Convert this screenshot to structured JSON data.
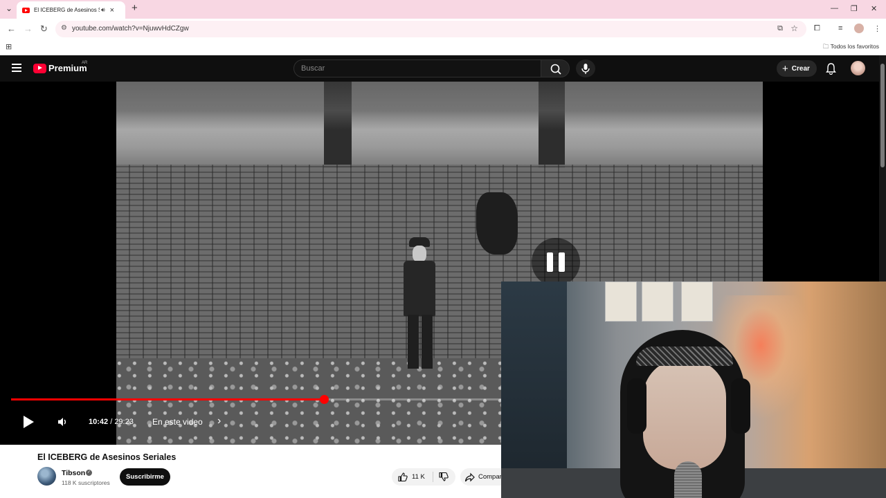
{
  "browser": {
    "tab_title": "El ICEBERG de Asesinos Seriales - YouTube",
    "url": "youtube.com/watch?v=NjuwvHdCZgw",
    "bookmarks_all": "Todos los favoritos"
  },
  "youtube": {
    "logo_text": "Premium",
    "logo_country": "AR",
    "search_placeholder": "Buscar",
    "create_label": "Crear"
  },
  "player": {
    "current_time": "10:42",
    "duration": "29:23",
    "time_separator": " / ",
    "chapter_label": "En este video",
    "progress": 0.365,
    "state": "paused",
    "accent_color": "#ff0000"
  },
  "video_info": {
    "title": "El ICEBERG de Asesinos Seriales",
    "channel_name": "Tibson",
    "subscribers": "118 K suscriptores",
    "subscribe_label": "Suscribirme",
    "likes": "11 K",
    "share_label": "Compartir"
  },
  "icons": [
    "menu-icon",
    "search-icon",
    "mic-icon",
    "bell-icon",
    "play-icon",
    "volume-icon",
    "like-icon",
    "dislike-icon",
    "share-icon"
  ]
}
